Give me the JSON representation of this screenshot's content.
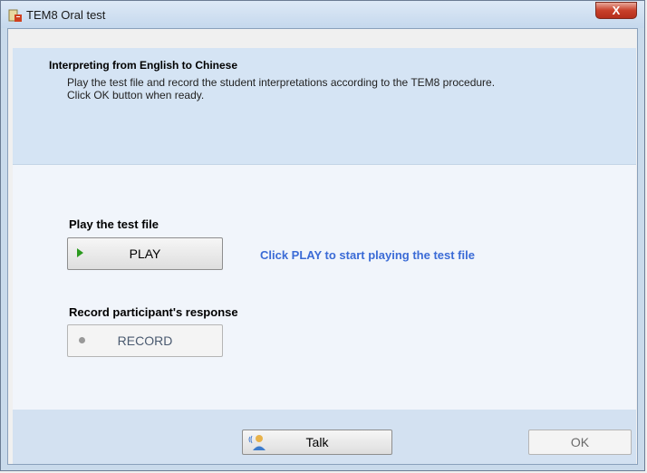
{
  "window": {
    "title": "TEM8 Oral test",
    "close_label": "X"
  },
  "header": {
    "heading": "Interpreting from English to Chinese",
    "desc_line1": "Play the test file and record the student interpretations according to the TEM8 procedure.",
    "desc_line2": "Click OK button when ready."
  },
  "play_section": {
    "label": "Play the test file",
    "button": "PLAY",
    "hint": "Click PLAY to start playing the test file"
  },
  "record_section": {
    "label": "Record participant's response",
    "button": "RECORD"
  },
  "footer": {
    "talk": "Talk",
    "ok": "OK"
  },
  "icons": {
    "app": "app-icon",
    "play": "play-icon",
    "record": "record-dot-icon",
    "talk": "talk-person-icon"
  },
  "colors": {
    "hint": "#3b6bd6",
    "header_bg": "#d5e4f4",
    "close_btn": "#c8402a"
  }
}
